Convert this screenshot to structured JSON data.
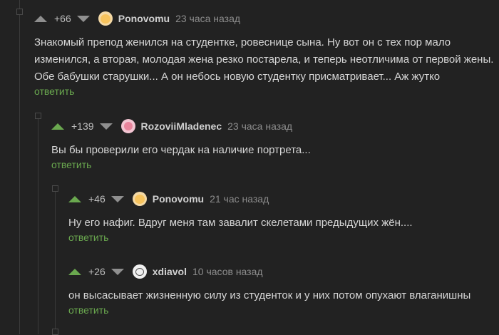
{
  "comments": [
    {
      "rating": "+66",
      "username": "Ponovomu",
      "time": "23 часа назад",
      "lines": [
        "Знакомый препод женился на студентке, ровеснице сына. Ну вот он с тех пор мало",
        "изменился, а вторая, молодая жена резко постарела, и теперь неотличима от первой жены.",
        "Обе бабушки старушки... А он небось новую студентку присматривает... Аж жутко"
      ],
      "reply": "ответить"
    },
    {
      "rating": "+139",
      "username": "RozoviiMladenec",
      "time": "23 часа назад",
      "lines": [
        "Вы бы проверили его чердак на наличие портрета..."
      ],
      "reply": "ответить"
    },
    {
      "rating": "+46",
      "username": "Ponovomu",
      "time": "21 час назад",
      "lines": [
        "Ну его нафиг. Вдруг меня там завалит скелетами предыдущих жён...."
      ],
      "reply": "ответить"
    },
    {
      "rating": "+26",
      "username": "xdiavol",
      "time": "10 часов назад",
      "lines": [
        "он высасывает жизненную силу из студенток и у них потом опухают влаганишны"
      ],
      "reply": "ответить"
    }
  ],
  "colors": {
    "background": "#222222",
    "upvote_active": "#6aa84f",
    "vote_inactive": "#8f8f8f",
    "reply_link": "#6aa84f"
  },
  "icons": {
    "upvote": "triangle-up-icon",
    "downvote": "triangle-down-icon",
    "collapse": "collapse-box-icon"
  }
}
